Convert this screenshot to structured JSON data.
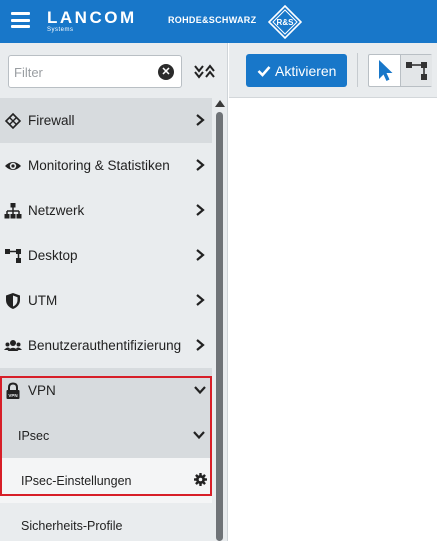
{
  "header": {
    "brand_name": "LANCOM",
    "brand_sub": "Systems",
    "partner_name": "ROHDE&SCHWARZ",
    "partner_logo_text": "R&S"
  },
  "filter": {
    "placeholder": "Filter",
    "value": ""
  },
  "toolbar": {
    "activate_label": "Aktivieren"
  },
  "nav": {
    "items": [
      {
        "label": "Firewall",
        "icon": "firewall-icon"
      },
      {
        "label": "Monitoring & Statistiken",
        "icon": "eye-icon"
      },
      {
        "label": "Netzwerk",
        "icon": "network-icon"
      },
      {
        "label": "Desktop",
        "icon": "desktop-icon"
      },
      {
        "label": "UTM",
        "icon": "shield-icon"
      },
      {
        "label": "Benutzerauthentifizierung",
        "icon": "users-icon"
      },
      {
        "label": "VPN",
        "icon": "lock-icon"
      }
    ],
    "vpn_sub": {
      "ipsec": "IPsec",
      "ipsec_settings": "IPsec-Einstellungen",
      "security_profiles": "Sicherheits-Profile"
    }
  },
  "colors": {
    "header": "#1877c9",
    "highlight": "#d71e28",
    "panel": "#e9ecee"
  }
}
